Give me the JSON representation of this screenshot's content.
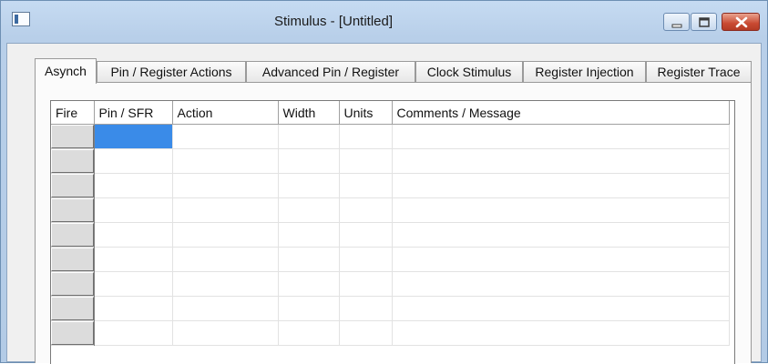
{
  "window": {
    "title": "Stimulus - [Untitled]",
    "controls": {
      "minimize_icon": "minimize-icon",
      "maximize_icon": "maximize-icon",
      "close_icon": "close-icon"
    }
  },
  "tabs": [
    {
      "label": "Asynch",
      "active": true
    },
    {
      "label": "Pin / Register Actions",
      "active": false
    },
    {
      "label": "Advanced Pin / Register",
      "active": false
    },
    {
      "label": "Clock Stimulus",
      "active": false
    },
    {
      "label": "Register Injection",
      "active": false
    },
    {
      "label": "Register Trace",
      "active": false
    }
  ],
  "grid": {
    "columns": [
      "Fire",
      "Pin / SFR",
      "Action",
      "Width",
      "Units",
      "Comments / Message"
    ],
    "rows": [
      [
        "",
        "",
        "",
        "",
        "",
        ""
      ],
      [
        "",
        "",
        "",
        "",
        "",
        ""
      ],
      [
        "",
        "",
        "",
        "",
        "",
        ""
      ],
      [
        "",
        "",
        "",
        "",
        "",
        ""
      ],
      [
        "",
        "",
        "",
        "",
        "",
        ""
      ],
      [
        "",
        "",
        "",
        "",
        "",
        ""
      ],
      [
        "",
        "",
        "",
        "",
        "",
        ""
      ],
      [
        "",
        "",
        "",
        "",
        "",
        ""
      ],
      [
        "",
        "",
        "",
        "",
        "",
        ""
      ]
    ],
    "selected_cell": {
      "row": 0,
      "column": "Pin / SFR"
    },
    "selection_color": "#3a8be8"
  }
}
